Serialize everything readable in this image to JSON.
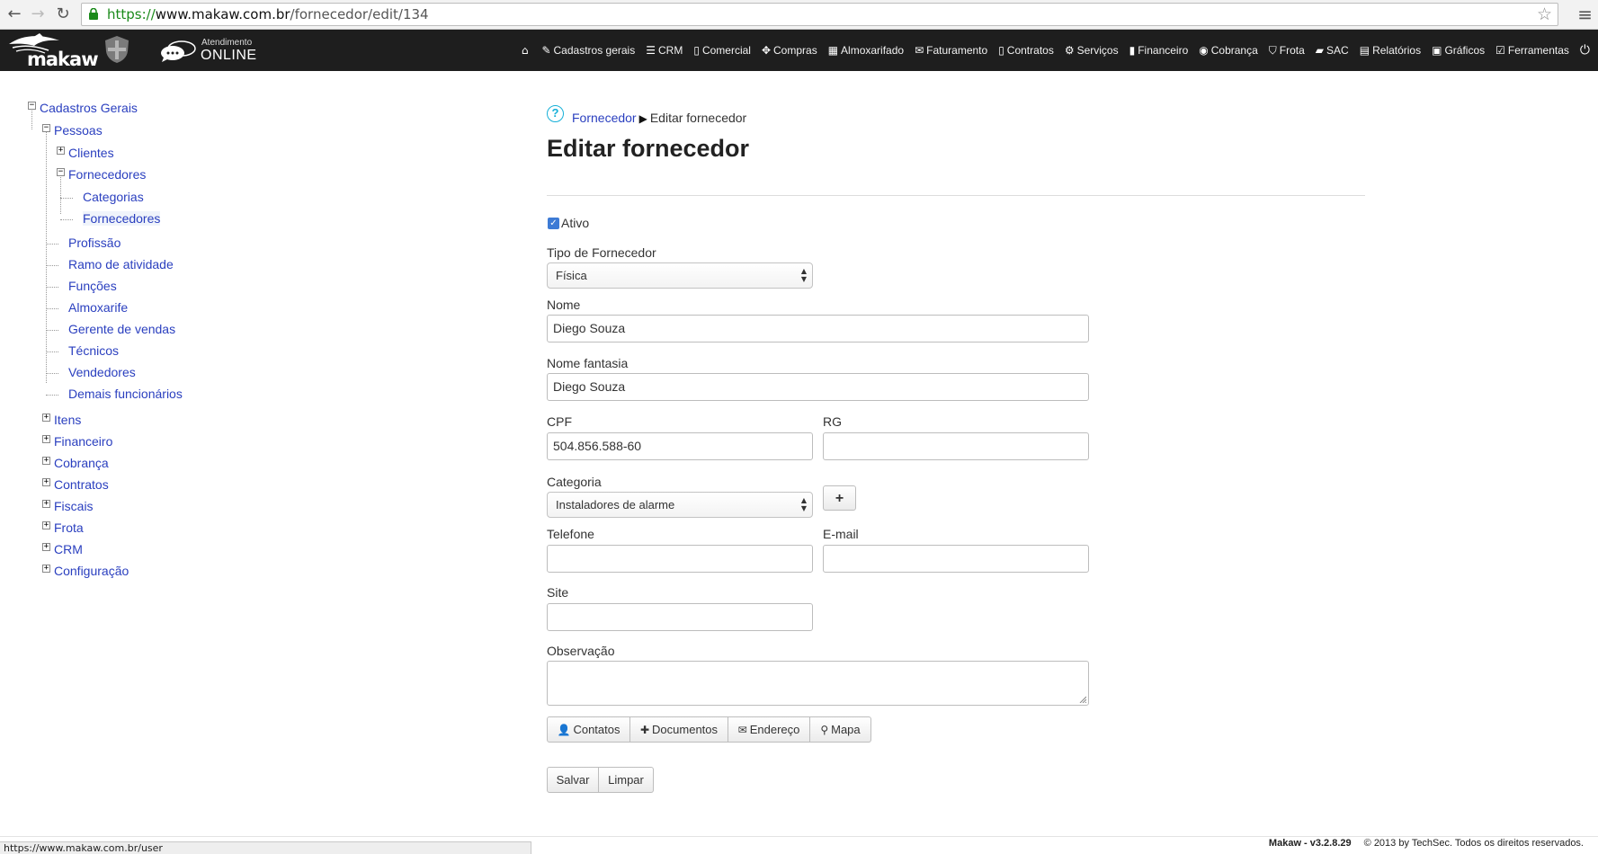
{
  "browser": {
    "url_protocol": "https://",
    "url_host": "www.makaw.com.br",
    "url_path": "/fornecedor/edit/134",
    "status_url": "https://www.makaw.com.br/user"
  },
  "header": {
    "logo_text": "makaw",
    "atendimento_line1": "Atendimento",
    "atendimento_line2": "ONLINE",
    "nav": [
      {
        "label": "Cadastros gerais",
        "icon": "pencil-icon"
      },
      {
        "label": "CRM",
        "icon": "list-icon"
      },
      {
        "label": "Comercial",
        "icon": "file-icon"
      },
      {
        "label": "Compras",
        "icon": "move-icon"
      },
      {
        "label": "Almoxarifado",
        "icon": "grid-icon"
      },
      {
        "label": "Faturamento",
        "icon": "envelope-icon"
      },
      {
        "label": "Contratos",
        "icon": "file-icon"
      },
      {
        "label": "Serviços",
        "icon": "gear-icon"
      },
      {
        "label": "Financeiro",
        "icon": "book-icon"
      },
      {
        "label": "Cobrança",
        "icon": "eye-icon"
      },
      {
        "label": "Frota",
        "icon": "road-icon"
      },
      {
        "label": "SAC",
        "icon": "comment-icon"
      },
      {
        "label": "Relatórios",
        "icon": "list-alt-icon"
      },
      {
        "label": "Gráficos",
        "icon": "picture-icon"
      },
      {
        "label": "Ferramentas",
        "icon": "edit-icon"
      }
    ]
  },
  "tree": {
    "root": "Cadastros Gerais",
    "pessoas": "Pessoas",
    "clientes": "Clientes",
    "fornecedores_group": "Fornecedores",
    "categorias": "Categorias",
    "fornecedores": "Fornecedores",
    "profissao": "Profissão",
    "ramo": "Ramo de atividade",
    "funcoes": "Funções",
    "almoxarife": "Almoxarife",
    "gerente": "Gerente de vendas",
    "tecnicos": "Técnicos",
    "vendedores": "Vendedores",
    "demais": "Demais funcionários",
    "itens": "Itens",
    "financeiro": "Financeiro",
    "cobranca": "Cobrança",
    "contratos": "Contratos",
    "fiscais": "Fiscais",
    "frota": "Frota",
    "crm": "CRM",
    "configuracao": "Configuração"
  },
  "breadcrumb": {
    "parent": "Fornecedor",
    "current": "Editar fornecedor"
  },
  "form": {
    "title": "Editar fornecedor",
    "ativo_label": "Ativo",
    "tipo_label": "Tipo de Fornecedor",
    "tipo_value": "Física",
    "nome_label": "Nome",
    "nome_value": "Diego Souza",
    "fantasia_label": "Nome fantasia",
    "fantasia_value": "Diego Souza",
    "cpf_label": "CPF",
    "cpf_value": "504.856.588-60",
    "rg_label": "RG",
    "rg_value": "",
    "categoria_label": "Categoria",
    "categoria_value": "Instaladores de alarme",
    "add_button": "+",
    "telefone_label": "Telefone",
    "telefone_value": "",
    "email_label": "E-mail",
    "email_value": "",
    "site_label": "Site",
    "site_value": "",
    "observacao_label": "Observação",
    "tabs": {
      "contatos": "Contatos",
      "documentos": "Documentos",
      "endereco": "Endereço",
      "mapa": "Mapa"
    },
    "salvar": "Salvar",
    "limpar": "Limpar"
  },
  "footer": {
    "version": "Makaw - v3.2.8.29",
    "copyright": "© 2013 by TechSec. Todos os direitos reservados."
  },
  "colors": {
    "link": "#2a3fbf",
    "header_bg": "#1e1e1e",
    "help": "#16b0d8",
    "url_protocol": "#1a8a1a"
  }
}
